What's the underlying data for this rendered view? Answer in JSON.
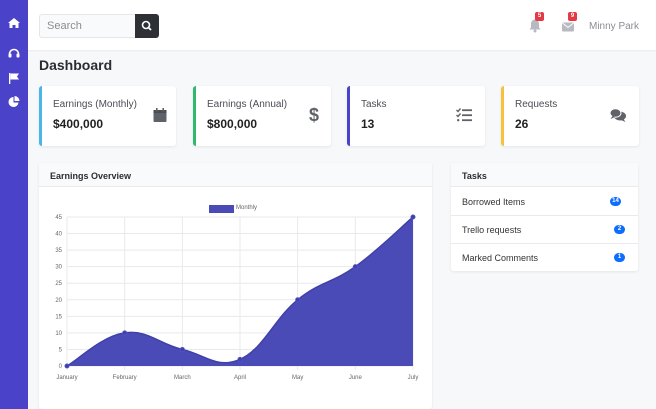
{
  "search": {
    "placeholder": "Search"
  },
  "topbar": {
    "alerts_count": "5",
    "messages_count": "9",
    "user_name": "Minny Park"
  },
  "page": {
    "title": "Dashboard"
  },
  "cards": [
    {
      "label": "Earnings (Monthly)",
      "value": "$400,000",
      "icon": "calendar-icon",
      "accent": "#4ab5e8"
    },
    {
      "label": "Earnings (Annual)",
      "value": "$800,000",
      "icon": "dollar-icon",
      "accent": "#2fb96d"
    },
    {
      "label": "Tasks",
      "value": "13",
      "icon": "checklist-icon",
      "accent": "#4a43c9"
    },
    {
      "label": "Requests",
      "value": "26",
      "icon": "comments-icon",
      "accent": "#f6c23e"
    }
  ],
  "earnings_panel": {
    "title": "Earnings Overview"
  },
  "tasks_panel": {
    "title": "Tasks",
    "items": [
      {
        "label": "Borrowed Items",
        "count": "14"
      },
      {
        "label": "Trello requests",
        "count": "2"
      },
      {
        "label": "Marked Comments",
        "count": "1"
      }
    ]
  },
  "colors": {
    "sidebar": "#4a43c9",
    "chart_fill": "#4a4bb7",
    "badge_red": "#e43a45",
    "pill_blue": "#0d6efd"
  },
  "chart_data": {
    "type": "area",
    "categories": [
      "January",
      "February",
      "March",
      "April",
      "May",
      "June",
      "July"
    ],
    "series": [
      {
        "name": "Monthly",
        "values": [
          0,
          10,
          5,
          2,
          20,
          30,
          45
        ]
      }
    ],
    "ylim": [
      0,
      45
    ],
    "yticks": [
      "0",
      "5",
      "10",
      "15",
      "20",
      "25",
      "30",
      "35",
      "40",
      "45"
    ],
    "legend": "top",
    "grid": true
  }
}
